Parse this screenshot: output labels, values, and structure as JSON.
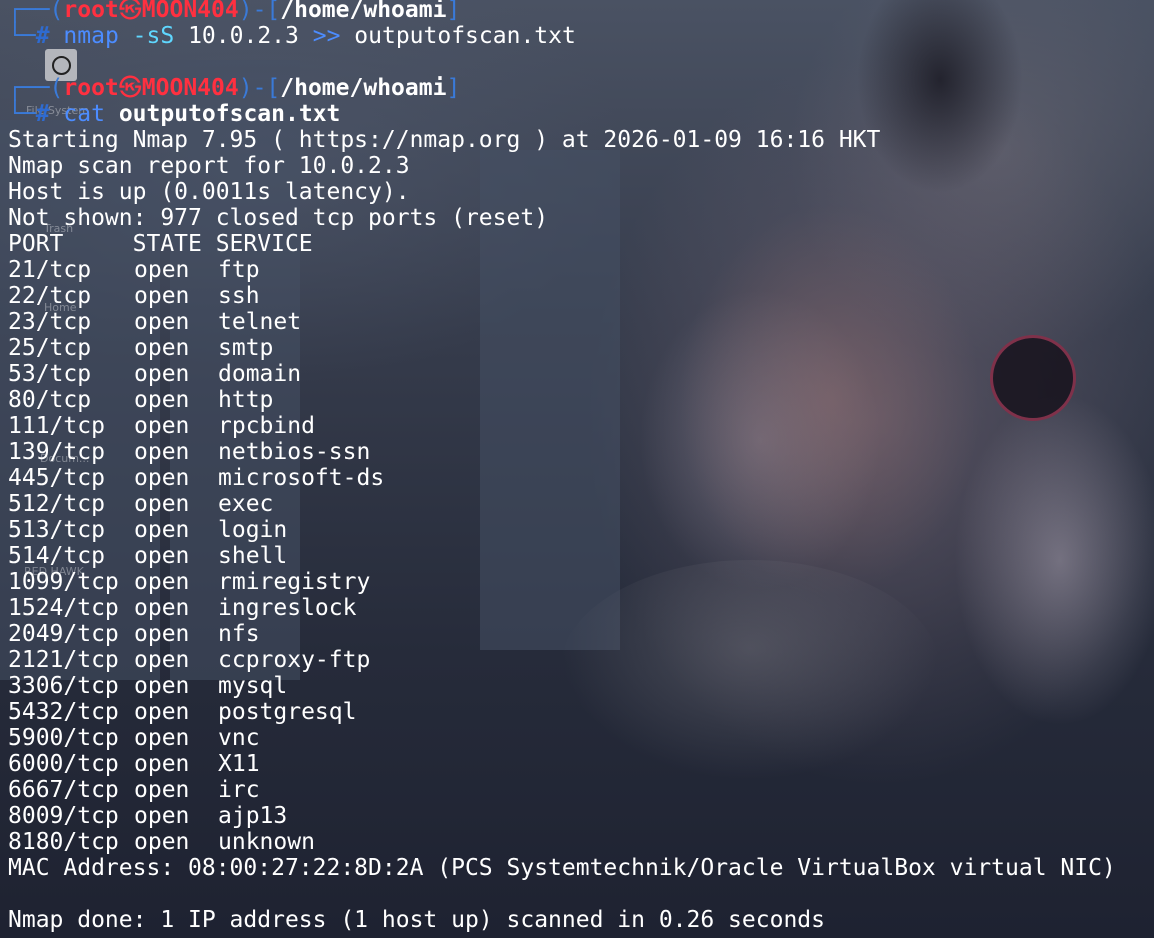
{
  "desktop": {
    "icon_labels": [
      "File System",
      "Trash",
      "Home",
      "Docum...",
      "RED HAWK"
    ]
  },
  "prompt1": {
    "user": "root",
    "symbol": "㉿",
    "host": "MOON404",
    "path": "/home/whoami",
    "command": "nmap",
    "flag": "-sS",
    "target": "10.0.2.3",
    "redirect": ">>",
    "file": "outputofscan.txt"
  },
  "prompt2": {
    "user": "root",
    "symbol": "㉿",
    "host": "MOON404",
    "path": "/home/whoami",
    "command": "cat",
    "file": "outputofscan.txt"
  },
  "output": {
    "start_line": "Starting Nmap 7.95 ( https://nmap.org ) at 2026-01-09 16:16 HKT",
    "report_line": "Nmap scan report for 10.0.2.3",
    "host_line": "Host is up (0.0011s latency).",
    "not_shown_line": "Not shown: 977 closed tcp ports (reset)",
    "header": "PORT     STATE SERVICE",
    "ports": [
      {
        "port": "21/tcp",
        "state": "open",
        "service": "ftp"
      },
      {
        "port": "22/tcp",
        "state": "open",
        "service": "ssh"
      },
      {
        "port": "23/tcp",
        "state": "open",
        "service": "telnet"
      },
      {
        "port": "25/tcp",
        "state": "open",
        "service": "smtp"
      },
      {
        "port": "53/tcp",
        "state": "open",
        "service": "domain"
      },
      {
        "port": "80/tcp",
        "state": "open",
        "service": "http"
      },
      {
        "port": "111/tcp",
        "state": "open",
        "service": "rpcbind"
      },
      {
        "port": "139/tcp",
        "state": "open",
        "service": "netbios-ssn"
      },
      {
        "port": "445/tcp",
        "state": "open",
        "service": "microsoft-ds"
      },
      {
        "port": "512/tcp",
        "state": "open",
        "service": "exec"
      },
      {
        "port": "513/tcp",
        "state": "open",
        "service": "login"
      },
      {
        "port": "514/tcp",
        "state": "open",
        "service": "shell"
      },
      {
        "port": "1099/tcp",
        "state": "open",
        "service": "rmiregistry"
      },
      {
        "port": "1524/tcp",
        "state": "open",
        "service": "ingreslock"
      },
      {
        "port": "2049/tcp",
        "state": "open",
        "service": "nfs"
      },
      {
        "port": "2121/tcp",
        "state": "open",
        "service": "ccproxy-ftp"
      },
      {
        "port": "3306/tcp",
        "state": "open",
        "service": "mysql"
      },
      {
        "port": "5432/tcp",
        "state": "open",
        "service": "postgresql"
      },
      {
        "port": "5900/tcp",
        "state": "open",
        "service": "vnc"
      },
      {
        "port": "6000/tcp",
        "state": "open",
        "service": "X11"
      },
      {
        "port": "6667/tcp",
        "state": "open",
        "service": "irc"
      },
      {
        "port": "8009/tcp",
        "state": "open",
        "service": "ajp13"
      },
      {
        "port": "8180/tcp",
        "state": "open",
        "service": "unknown"
      }
    ],
    "mac_line": "MAC Address: 08:00:27:22:8D:2A (PCS Systemtechnik/Oracle VirtualBox virtual NIC)",
    "done_line": "Nmap done: 1 IP address (1 host up) scanned in 0.26 seconds"
  },
  "colors": {
    "prompt_frame": "#3a7ad8",
    "user_host": "#ff3040",
    "path": "#ffffff",
    "command": "#4c8cff"
  }
}
